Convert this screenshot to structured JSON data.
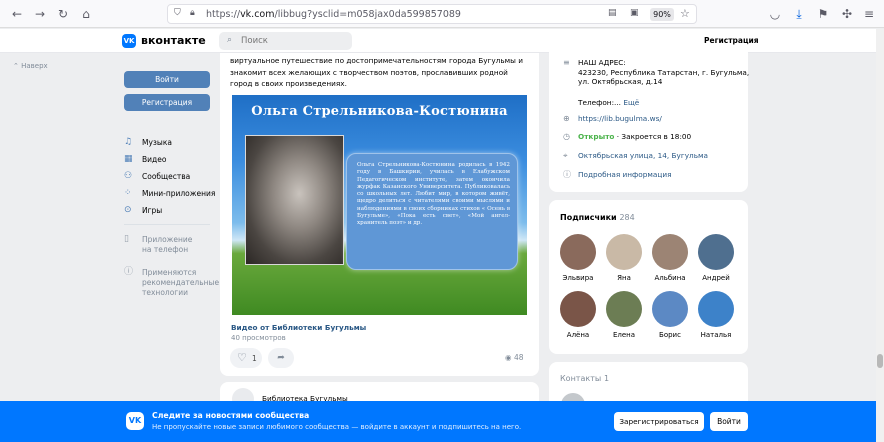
{
  "browser": {
    "url_prefix": "https://",
    "url_domain": "vk.com",
    "url_path": "/libbug?ysclid=m058jax0da599857089",
    "zoom": "90%"
  },
  "header": {
    "logo_text": "VK",
    "brand": "вконтакте",
    "search_placeholder": "Поиск",
    "register_link": "Регистрация"
  },
  "sidebar": {
    "back_to_top": "Наверх",
    "login_button": "Войти",
    "register_button": "Регистрация",
    "items": [
      {
        "label": "Музыка",
        "icon": "music-icon"
      },
      {
        "label": "Видео",
        "icon": "video-icon"
      },
      {
        "label": "Сообщества",
        "icon": "communities-icon"
      },
      {
        "label": "Мини-приложения",
        "icon": "apps-icon"
      },
      {
        "label": "Игры",
        "icon": "games-icon"
      }
    ],
    "phone_app": "Приложение на телефон",
    "recommendation_tech": "Применяются рекомендательные технологии"
  },
  "post": {
    "text": "виртуальное путешествие по достопримечательностям города Бугульмы и знакомит всех желающих с творчеством поэтов, прославивших родной город в своих произведениях.",
    "video": {
      "title": "Ольга Стрельникова-Костюнина",
      "bio": "Ольга Стрельникова-Костюнина родилась в 1942 году в Башкирии, училась в Елабужском Педагогическом институте, затем окончила журфак Казанского Университета. Публиковалась со школьных лет. Любит мир, в котором живёт, щедро делиться с читателями своими мыслями и наблюдениями в своих сборниках стихов « Осень в Бугульме», «Пока есть свет», «Мой ангел- хранитель поэт» и др."
    },
    "video_link": "Видео от Библиотеки Бугульмы",
    "views": "40 просмотров",
    "likes": "1",
    "view_count": "48"
  },
  "next_post": {
    "author": "Библиотека Бугульмы"
  },
  "info": {
    "address_label": "НАШ АДРЕС:",
    "address_line1": "423230, Республика Татарстан, г. Бугульма,",
    "address_line2": "ул. Октябрьская, д.14",
    "phone_label": "Телефон:...",
    "phone_more": "Ещё",
    "website": "https://lib.bugulma.ws/",
    "status_open": "Открыто",
    "status_close": "· Закроется в 18:00",
    "location": "Октябрьская улица, 14, Бугульма",
    "details": "Подробная информация"
  },
  "subscribers": {
    "title": "Подписчики",
    "count": "284",
    "people": [
      {
        "name": "Эльвира",
        "color": "#8a6a5c"
      },
      {
        "name": "Яна",
        "color": "#c9b9a6"
      },
      {
        "name": "Альбина",
        "color": "#9c8474"
      },
      {
        "name": "Андрей",
        "color": "#4f6f8f"
      },
      {
        "name": "Алёна",
        "color": "#7a5548"
      },
      {
        "name": "Елена",
        "color": "#6c7d54"
      },
      {
        "name": "Борис",
        "color": "#5c89c4"
      },
      {
        "name": "Наталья",
        "color": "#3d82c9"
      }
    ]
  },
  "contacts": {
    "title": "Контакты",
    "count": "1"
  },
  "banner": {
    "logo_text": "VK",
    "title": "Следите за новостями сообщества",
    "subtitle": "Не пропускайте новые записи любимого сообщества — войдите в аккаунт и подпишитесь на него.",
    "register_button": "Зарегистрироваться",
    "login_button": "Войти"
  },
  "colors": {
    "vk_blue": "#0077ff",
    "button_blue": "#5181b8",
    "link": "#2a5885",
    "open_green": "#4bb34b"
  }
}
